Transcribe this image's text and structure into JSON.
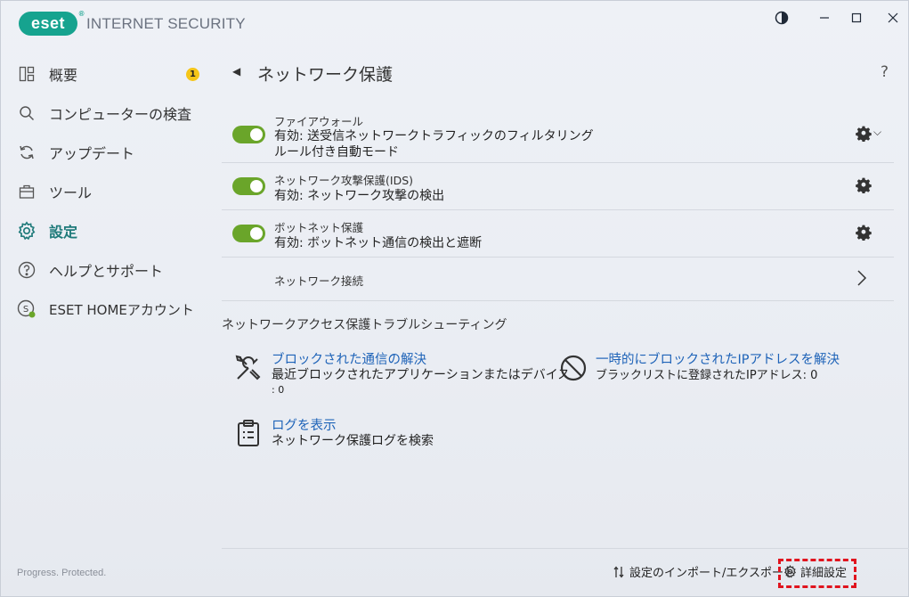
{
  "app": {
    "logo_text": "eset",
    "product_name": "INTERNET SECURITY",
    "brand_color": "#16a38f"
  },
  "window_controls": {
    "theme_icon": "contrast-icon",
    "minimize": "minimize-icon",
    "maximize": "maximize-icon",
    "close": "close-icon"
  },
  "sidebar": {
    "items": [
      {
        "label": "概要",
        "icon": "overview-icon",
        "badge": "1"
      },
      {
        "label": "コンピューターの検査",
        "icon": "search-icon"
      },
      {
        "label": "アップデート",
        "icon": "refresh-icon"
      },
      {
        "label": "ツール",
        "icon": "toolbox-icon"
      },
      {
        "label": "設定",
        "icon": "gear-icon",
        "active": true
      },
      {
        "label": "ヘルプとサポート",
        "icon": "help-icon"
      },
      {
        "label": "ESET HOMEアカウント",
        "icon": "account-icon"
      }
    ],
    "tagline": "Progress. Protected."
  },
  "main": {
    "title": "ネットワーク保護",
    "help": "?",
    "rows": [
      {
        "title": "ファイアウォール",
        "sub1": "有効: 送受信ネットワークトラフィックのフィルタリング",
        "sub2": "ルール付き自動モード",
        "enabled": true
      },
      {
        "title": "ネットワーク攻撃保護(IDS)",
        "sub1": "有効: ネットワーク攻撃の検出",
        "enabled": true
      },
      {
        "title": "ボットネット保護",
        "sub1": "有効: ボットネット通信の検出と遮断",
        "enabled": true
      },
      {
        "title": "ネットワーク接続"
      }
    ],
    "troubleshoot": {
      "title": "ネットワークアクセス保護トラブルシューティング",
      "items": [
        {
          "link": "ブロックされた通信の解決",
          "desc": "最近ブロックされたアプリケーションまたはデバイス",
          "count": ": 0"
        },
        {
          "link": "一時的にブロックされたIPアドレスを解決",
          "desc": "ブラックリストに登録されたIPアドレス: 0"
        },
        {
          "link": "ログを表示",
          "desc": "ネットワーク保護ログを検索"
        }
      ]
    }
  },
  "footer": {
    "import_export": "設定のインポート/エクスポート",
    "advanced": "詳細設定"
  },
  "colors": {
    "toggle_on": "#6aa52a",
    "link": "#1e63b8",
    "active_nav": "#1f7a7a",
    "highlight": "#e0141e"
  }
}
